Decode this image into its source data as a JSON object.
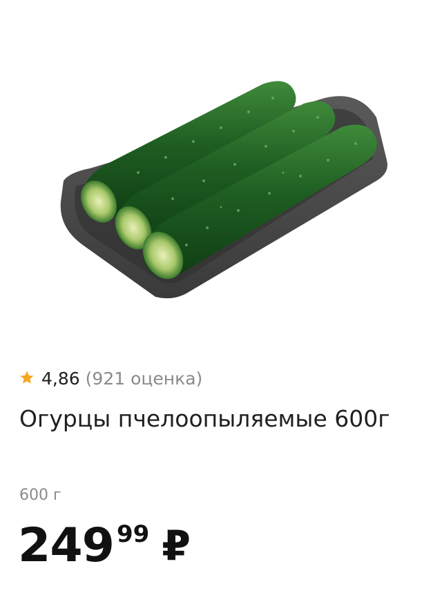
{
  "product": {
    "image_alt": "cucumbers-on-tray",
    "rating": {
      "value": "4,86",
      "count": "(921 оценка)",
      "star_icon": "star-icon",
      "star_color": "#f5a623"
    },
    "title": "Огурцы пчелоопыляемые 600г",
    "weight": "600 г",
    "price": {
      "whole": "249",
      "fraction": "99",
      "currency": "₽"
    }
  }
}
